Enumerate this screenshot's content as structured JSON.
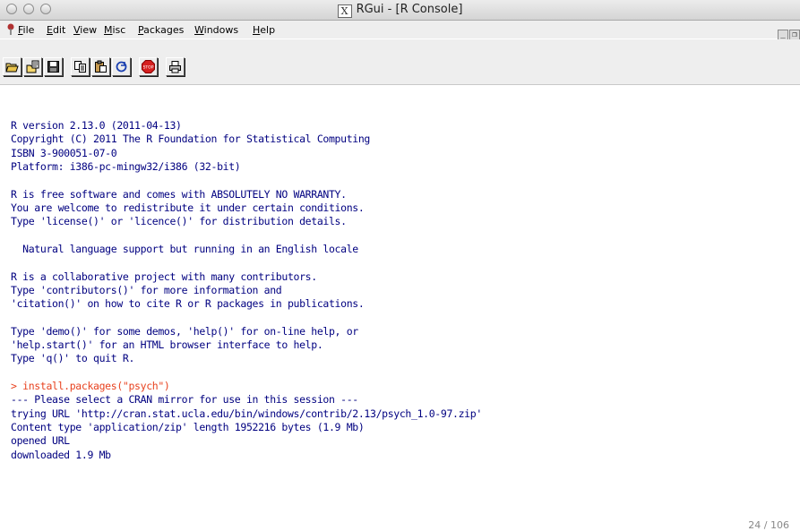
{
  "window": {
    "title": "RGui - [R Console]",
    "x11_icon": "X"
  },
  "menu": {
    "file": "File",
    "edit": "Edit",
    "view": "View",
    "misc": "Misc",
    "packages": "Packages",
    "windows": "Windows",
    "help": "Help"
  },
  "toolbar": {
    "icons": [
      "open-script-icon",
      "load-workspace-icon",
      "save-workspace-icon",
      "copy-icon",
      "paste-icon",
      "copy-paste-icon",
      "stop-icon",
      "print-icon"
    ],
    "stop_label": "STOP"
  },
  "console": {
    "lines": [
      "R version 2.13.0 (2011-04-13)",
      "Copyright (C) 2011 The R Foundation for Statistical Computing",
      "ISBN 3-900051-07-0",
      "Platform: i386-pc-mingw32/i386 (32-bit)",
      "",
      "R is free software and comes with ABSOLUTELY NO WARRANTY.",
      "You are welcome to redistribute it under certain conditions.",
      "Type 'license()' or 'licence()' for distribution details.",
      "",
      "  Natural language support but running in an English locale",
      "",
      "R is a collaborative project with many contributors.",
      "Type 'contributors()' for more information and",
      "'citation()' on how to cite R or R packages in publications.",
      "",
      "Type 'demo()' for some demos, 'help()' for on-line help, or",
      "'help.start()' for an HTML browser interface to help.",
      "Type 'q()' to quit R.",
      "",
      "> install.packages(\"psych\")",
      "--- Please select a CRAN mirror for use in this session ---",
      "trying URL 'http://cran.stat.ucla.edu/bin/windows/contrib/2.13/psych_1.0-97.zip'",
      "Content type 'application/zip' length 1952216 bytes (1.9 Mb)",
      "opened URL",
      "downloaded 1.9 Mb"
    ],
    "command_color": "#e8421f",
    "output_color": "#000080"
  },
  "page_number": "24 / 106"
}
